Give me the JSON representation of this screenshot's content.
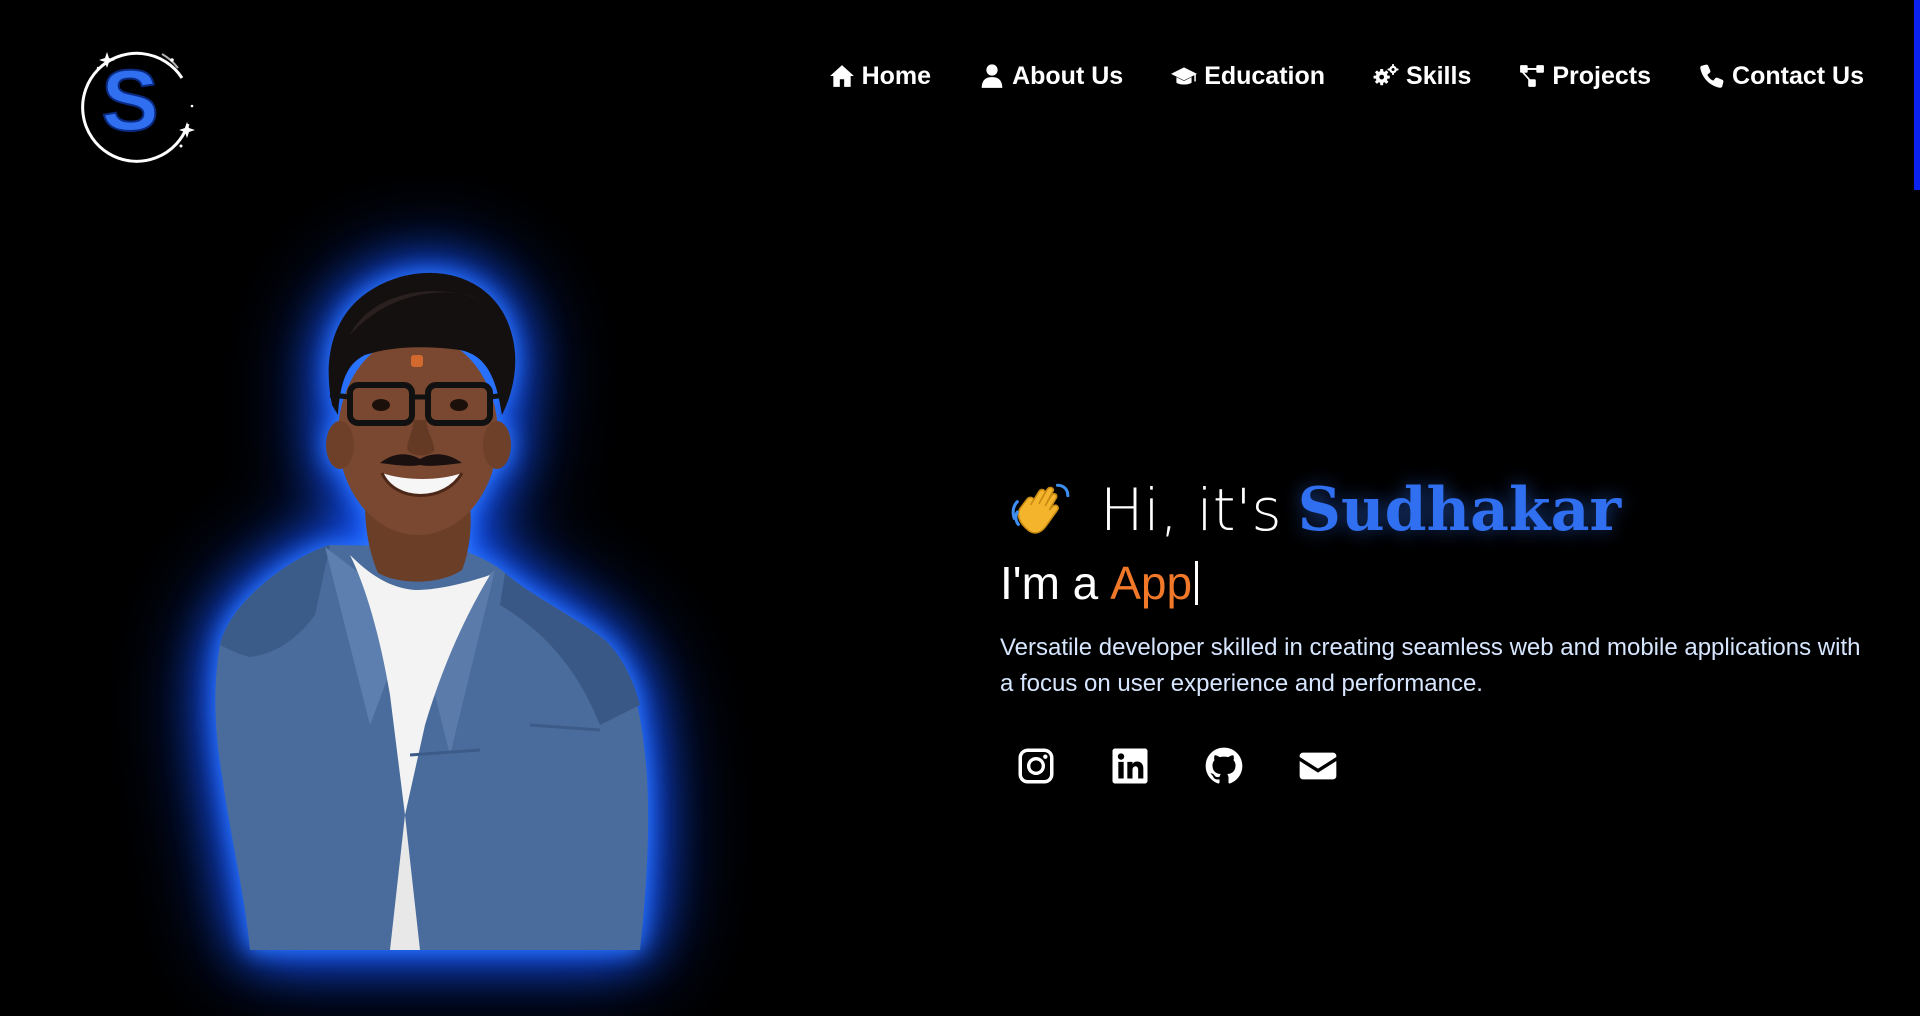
{
  "logo": {
    "letter": "S",
    "icon": "s-logo-icon",
    "accent_color": "#2f6ff0"
  },
  "nav": {
    "items": [
      {
        "label": "Home",
        "icon": "home-icon"
      },
      {
        "label": "About Us",
        "icon": "user-icon"
      },
      {
        "label": "Education",
        "icon": "graduation-cap-icon"
      },
      {
        "label": "Skills",
        "icon": "gears-icon"
      },
      {
        "label": "Projects",
        "icon": "diagram-icon"
      },
      {
        "label": "Contact Us",
        "icon": "phone-icon"
      }
    ]
  },
  "hero": {
    "wave_icon": "waving-hand-icon",
    "greeting": "Hi, it's",
    "name": "Sudhakar",
    "role_prefix": "I'm a",
    "role_word": "App",
    "description": "Versatile developer skilled in creating seamless web and mobile applications with a focus on user experience and performance.",
    "socials": [
      {
        "icon": "instagram-icon"
      },
      {
        "icon": "linkedin-icon"
      },
      {
        "icon": "github-icon"
      },
      {
        "icon": "email-icon"
      }
    ]
  },
  "portrait": {
    "icon": "profile-photo"
  },
  "colors": {
    "background": "#000000",
    "name": "#2f6ff0",
    "role_highlight": "#f07828",
    "glow": "#1a5cff",
    "description": "#d7e6ff",
    "scroll_indicator": "#0b22f0"
  }
}
